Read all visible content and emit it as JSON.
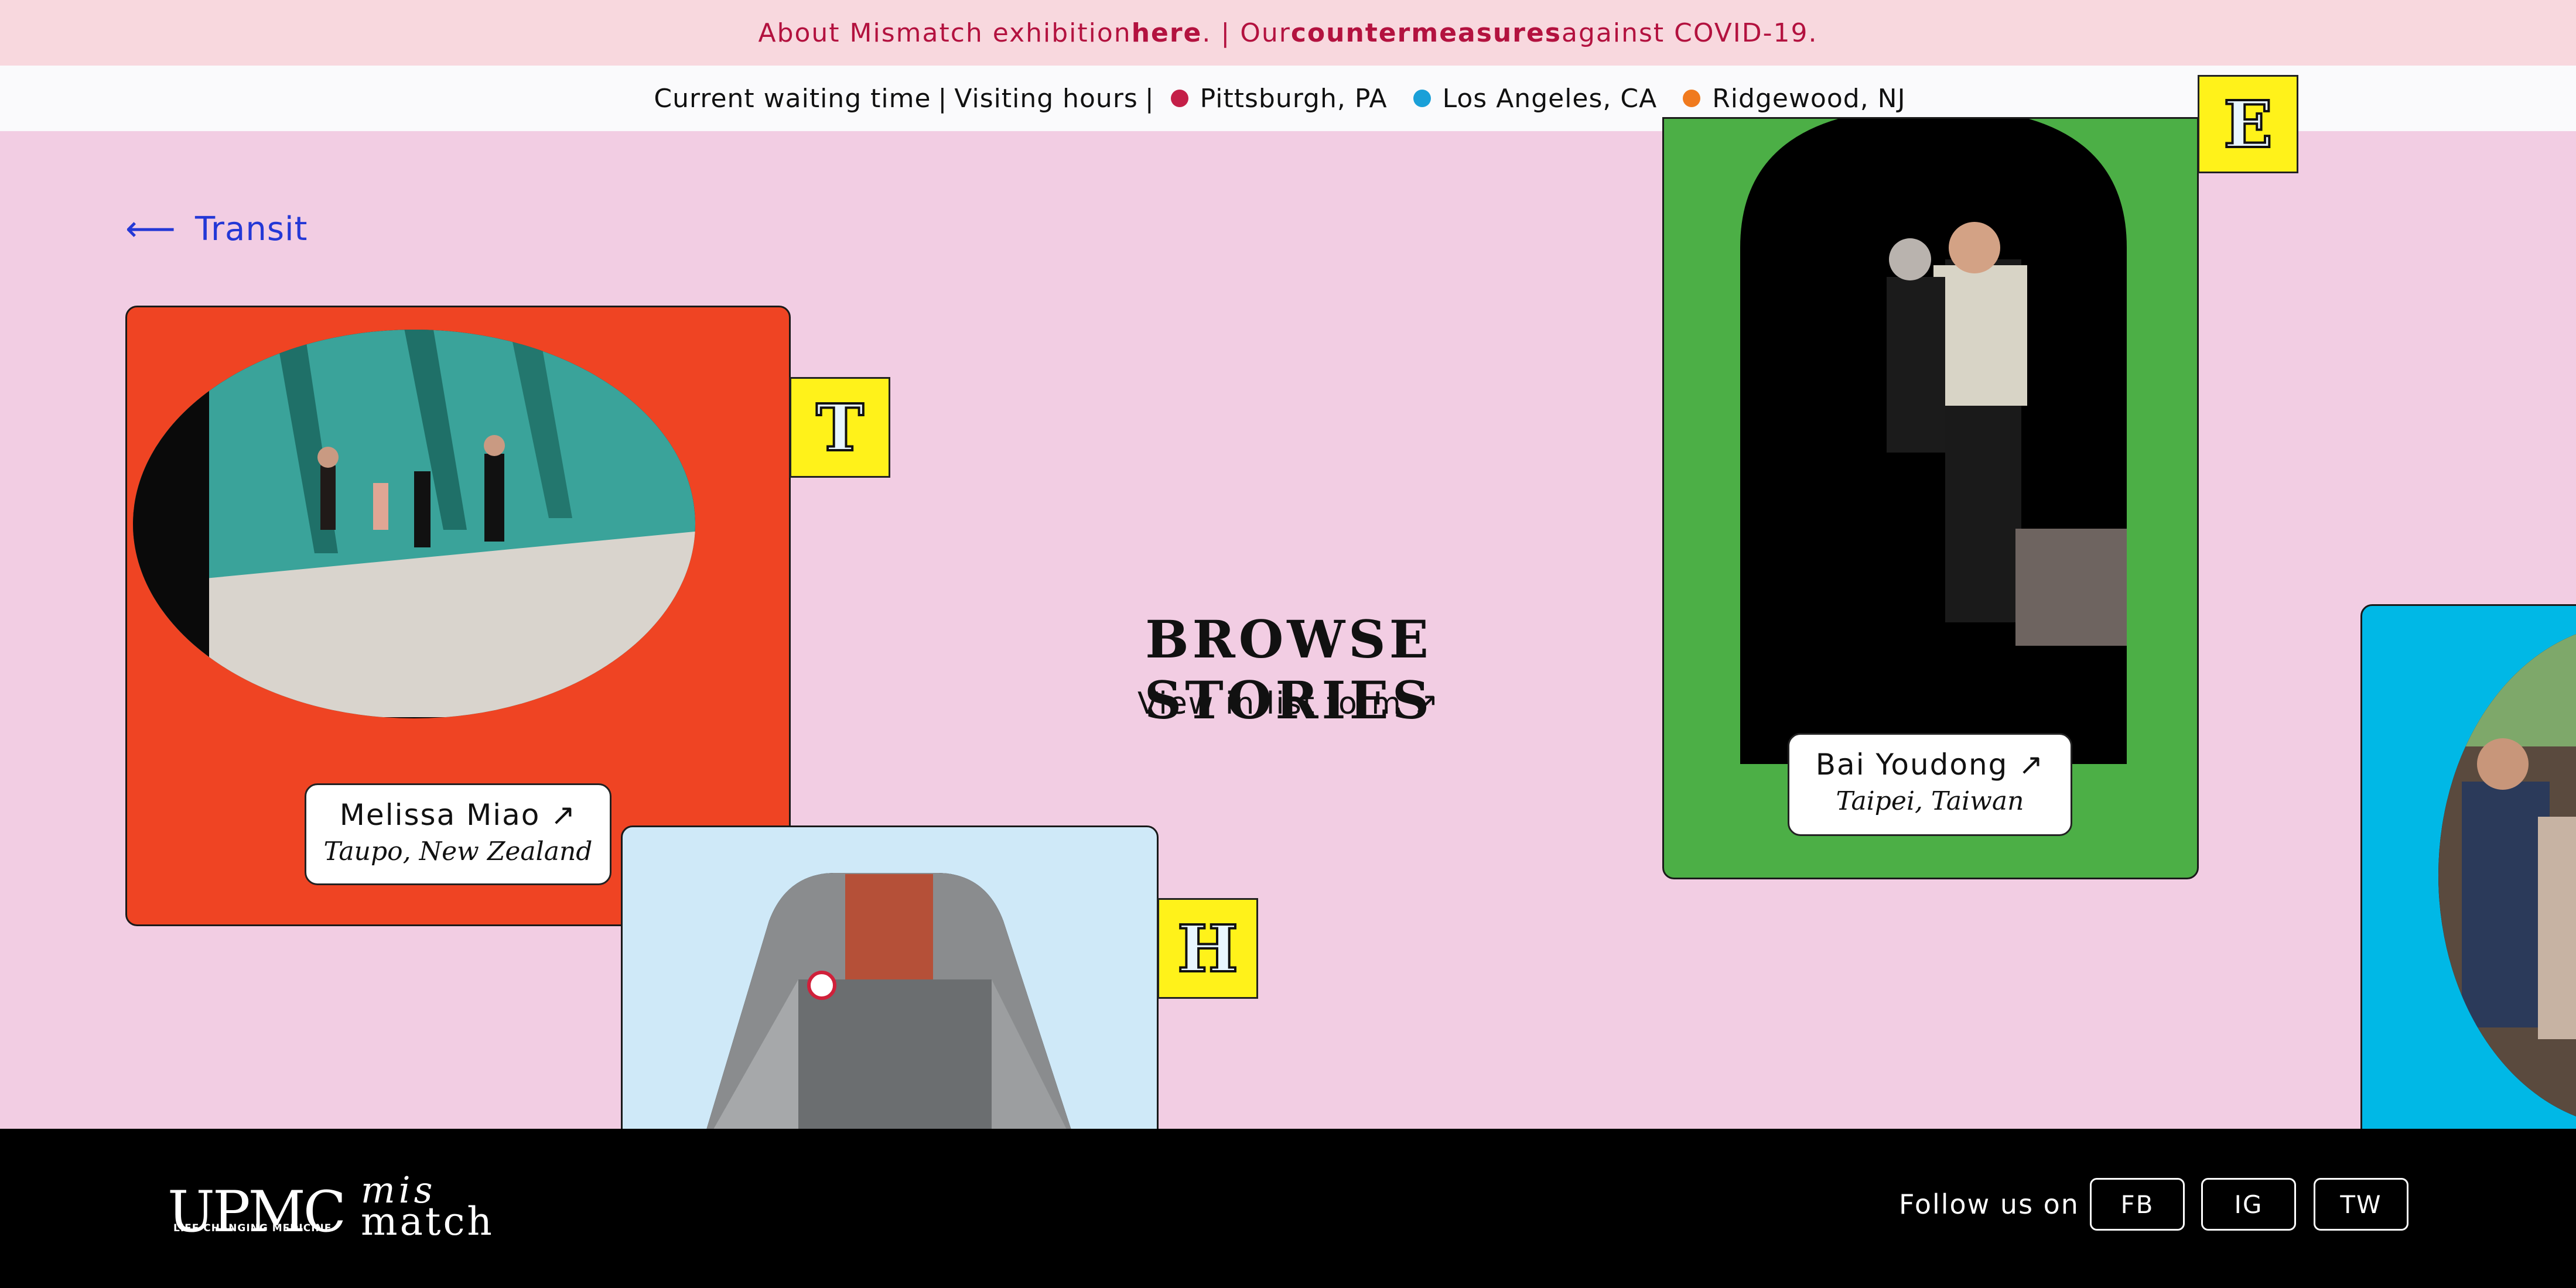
{
  "announcement": {
    "prefix": "About Mismatch exhibition ",
    "here_link": "here",
    "middle": ". | Our ",
    "countermeasures_link": "countermeasures",
    "suffix": " against COVID-19."
  },
  "location_bar": {
    "waiting_time": "Current waiting time",
    "visiting_hours": "Visiting hours",
    "separator": "|",
    "locations": [
      {
        "name": "Pittsburgh, PA",
        "color": "#c41f48"
      },
      {
        "name": "Los Angeles, CA",
        "color": "#1aa0d8"
      },
      {
        "name": "Ridgewood, NJ",
        "color": "#f07a1e"
      }
    ]
  },
  "back_link": {
    "icon": "arrow-left-icon",
    "label": "Transit"
  },
  "cards": [
    {
      "letter": "T",
      "name": "Melissa Miao",
      "place": "Taupo, New Zealand",
      "color": "#ef4423",
      "photo": "swimmers-on-pool-steps"
    },
    {
      "letter": "H",
      "name": "",
      "place": "",
      "color": "#cfe9f8",
      "photo": "subway-stairway-entrance"
    },
    {
      "letter": "E",
      "name": "Bai Youdong",
      "place": "Taipei, Taiwan",
      "color": "#4caf46",
      "photo": "elderly-couple-walking"
    },
    {
      "letter": "",
      "name": "",
      "place": "",
      "color": "#00b8e6",
      "photo": "crowd-street"
    }
  ],
  "center": {
    "heading": "Browse Stories",
    "list_link": "View in list form",
    "list_icon": "arrow-up-right-icon"
  },
  "footer": {
    "logo_main": "UPMC",
    "logo_sub": "LIFE CHANGING MEDICINE",
    "logo_mis": "mis",
    "logo_match": "match",
    "follow_label": "Follow us on",
    "social": [
      "FB",
      "IG",
      "TW"
    ]
  }
}
